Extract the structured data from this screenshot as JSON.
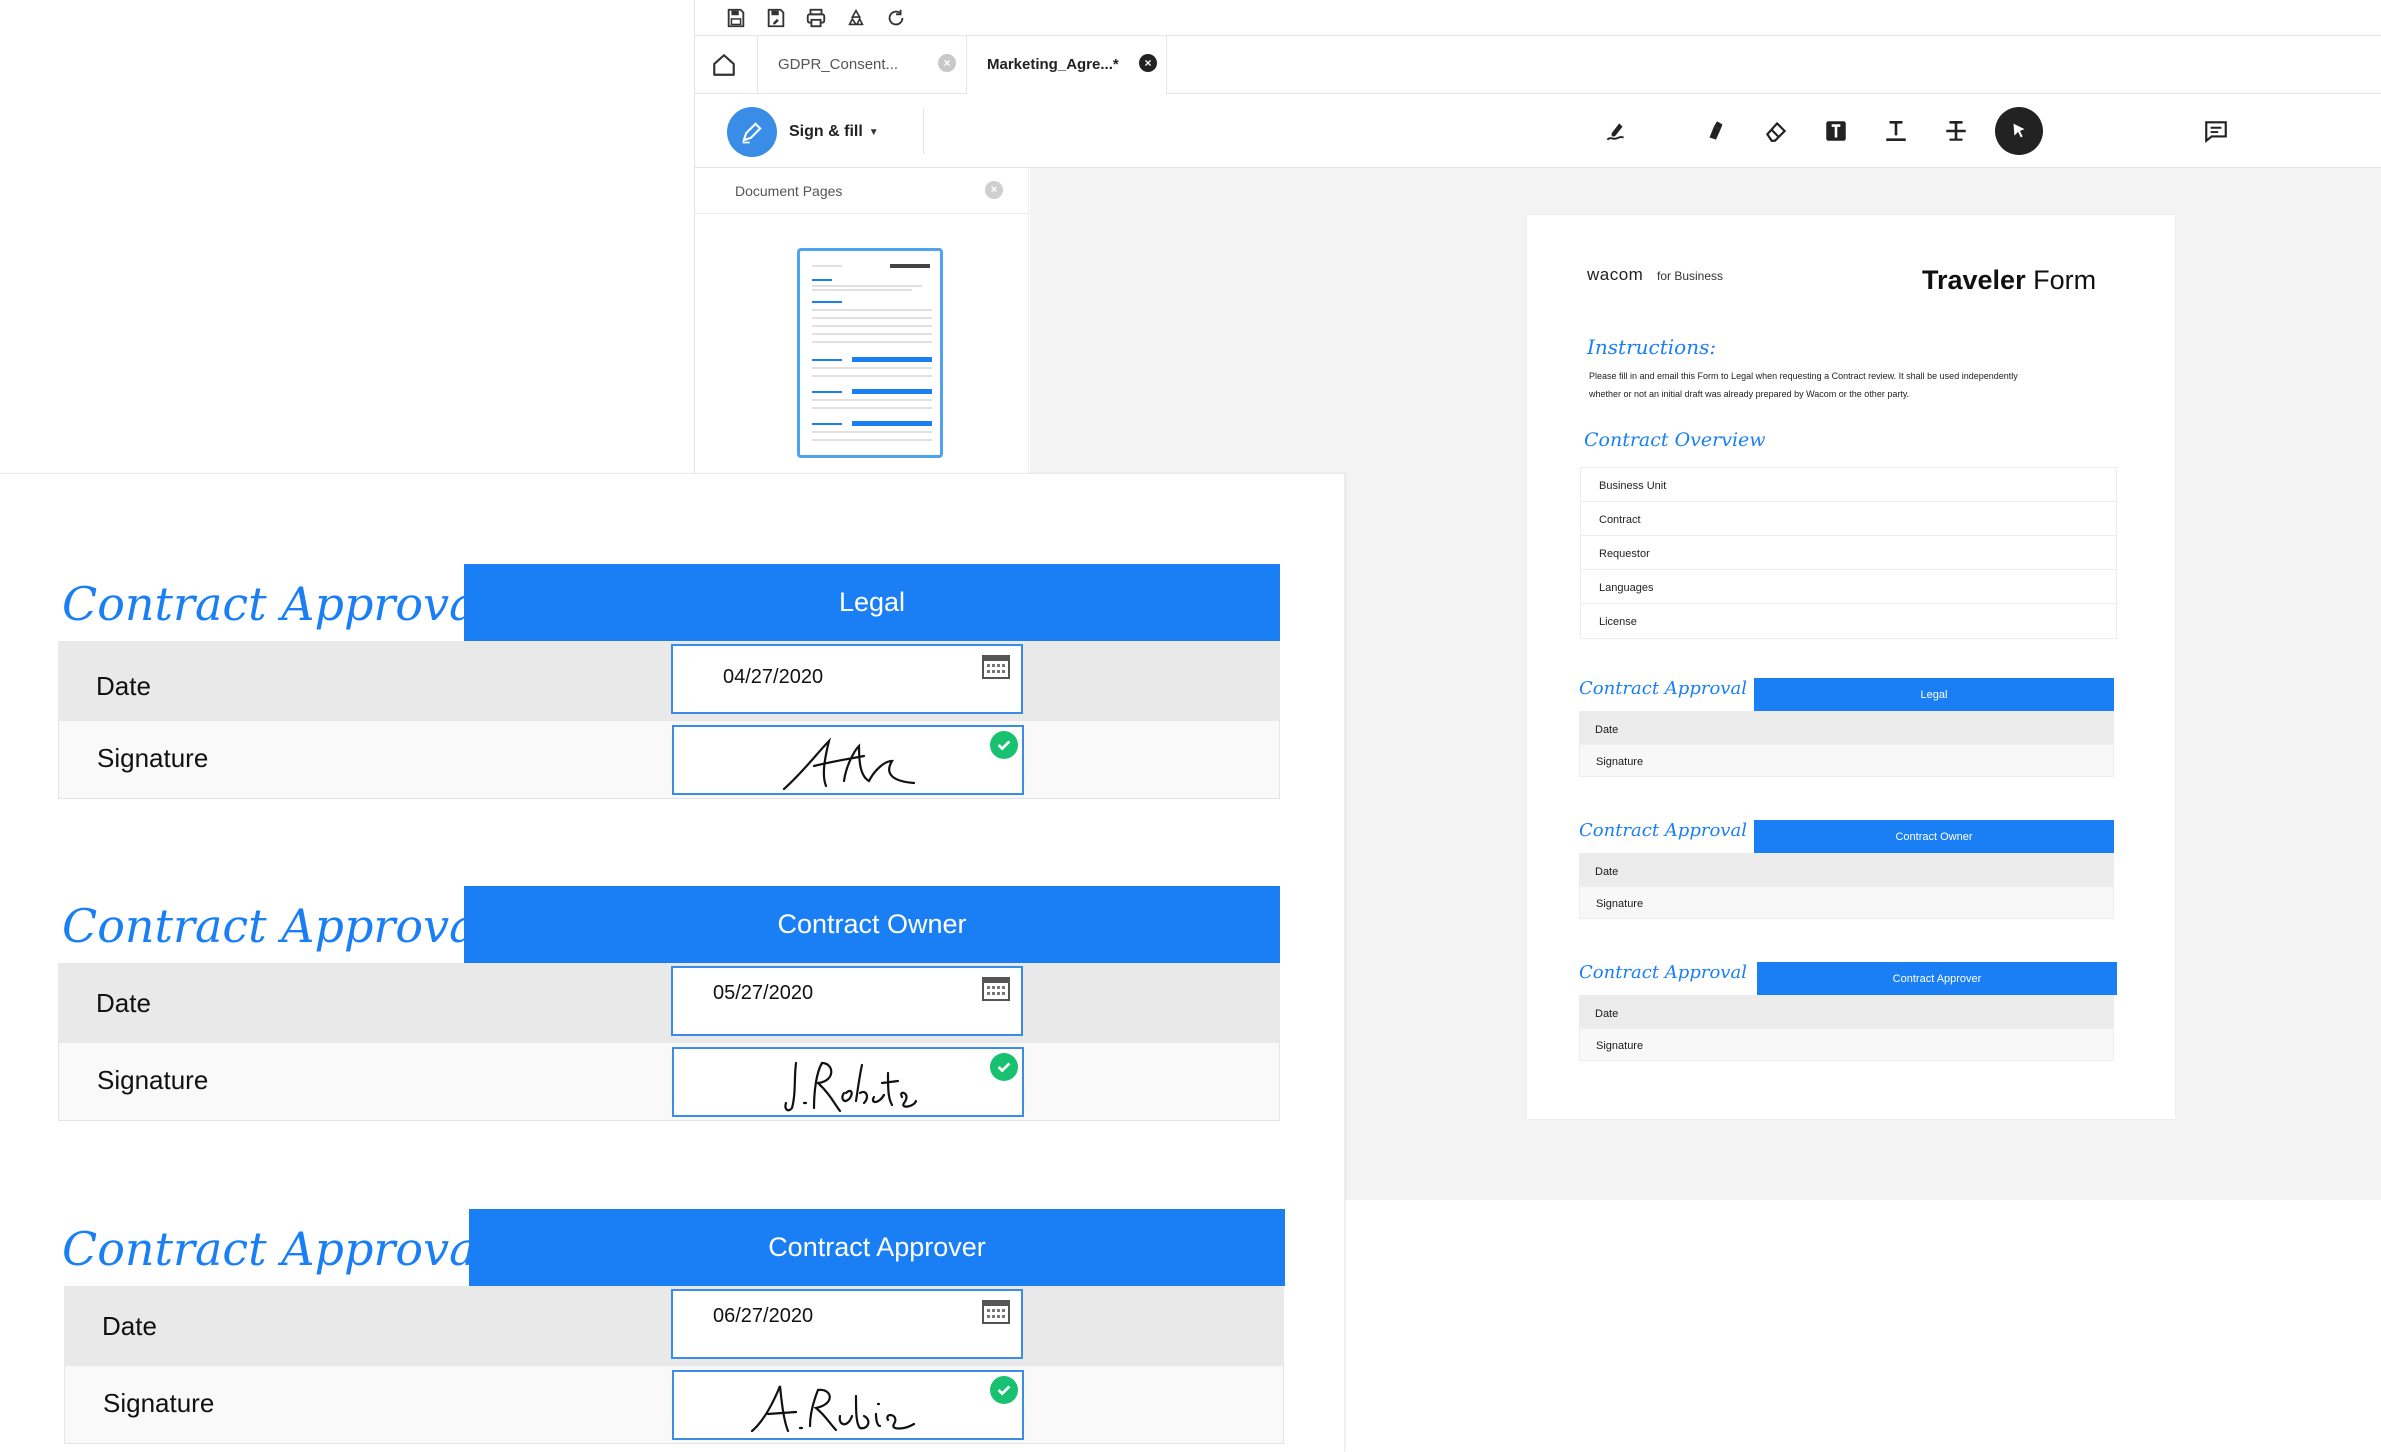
{
  "app": {
    "quick_icons": [
      "save-icon",
      "save-as-icon",
      "print-icon",
      "recycle-icon",
      "redo-icon"
    ],
    "tabs": [
      {
        "label": "GDPR_Consent...",
        "active": false
      },
      {
        "label": "Marketing_Agre...*",
        "active": true
      }
    ],
    "toolbar": {
      "sign_fill_label": "Sign & fill",
      "tools": [
        "pen-sign-icon",
        "highlighter-icon",
        "eraser-icon",
        "text-box-icon",
        "insert-text-icon",
        "strikethrough-icon",
        "select-pointer-icon",
        "comment-icon"
      ],
      "active_tool": "select-pointer-icon"
    },
    "pages_panel": {
      "title": "Document Pages"
    },
    "accent": "#1a7ff5"
  },
  "document": {
    "brand": "wacom",
    "brand_sub": "for Business",
    "title_bold": "Traveler",
    "title_rest": "Form",
    "instructions_heading": "Instructions:",
    "instructions_text": "Please fill in and email this Form to Legal when requesting a Contract review. It shall be used independently whether or not an initial draft was already prepared by Wacom or the other party.",
    "overview_heading": "Contract Overview",
    "overview_rows": [
      "Business Unit",
      "Contract",
      "Requestor",
      "Languages",
      "License"
    ],
    "approvals": [
      {
        "heading": "Contract Approval",
        "role": "Legal",
        "date_label": "Date",
        "signature_label": "Signature"
      },
      {
        "heading": "Contract Approval",
        "role": "Contract Owner",
        "date_label": "Date",
        "signature_label": "Signature"
      },
      {
        "heading": "Contract Approval",
        "role": "Contract Approver",
        "date_label": "Date",
        "signature_label": "Signature"
      }
    ]
  },
  "zoom": {
    "sections": [
      {
        "heading": "Contract Approval",
        "role": "Legal",
        "date_label": "Date",
        "date_value": "04/27/2020",
        "signature_label": "Signature",
        "signed": true
      },
      {
        "heading": "Contract Approval",
        "role": "Contract Owner",
        "date_label": "Date",
        "date_value": "05/27/2020",
        "signature_label": "Signature",
        "signed": true
      },
      {
        "heading": "Contract Approval",
        "role": "Contract Approver",
        "date_label": "Date",
        "date_value": "06/27/2020",
        "signature_label": "Signature",
        "signed": true
      }
    ]
  }
}
